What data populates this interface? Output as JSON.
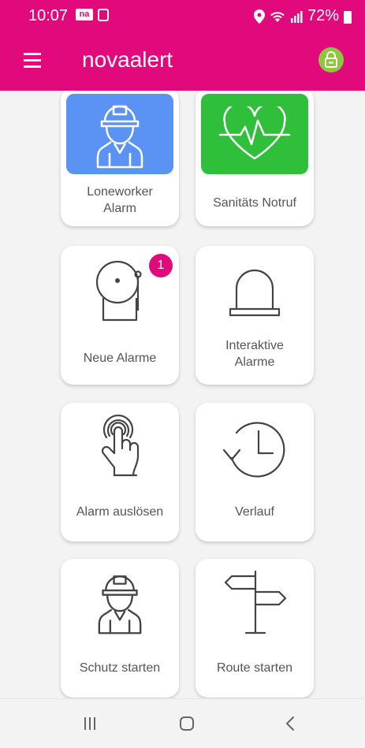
{
  "status": {
    "time": "10:07",
    "app_badge": "na",
    "battery": "72%"
  },
  "appbar": {
    "title": "novaalert",
    "menu_icon": "hamburger-menu-icon",
    "lock_icon": "lock-icon"
  },
  "tiles": [
    {
      "label": "Loneworker\nAlarm",
      "icon": "worker-icon"
    },
    {
      "label": "Sanitäts Notruf",
      "icon": "heart-pulse-icon"
    },
    {
      "label": "Neue Alarme",
      "icon": "bell-icon",
      "badge": "1"
    },
    {
      "label": "Interaktive\nAlarme",
      "icon": "siren-icon"
    },
    {
      "label": "Alarm auslösen",
      "icon": "touch-hand-icon"
    },
    {
      "label": "Verlauf",
      "icon": "history-icon"
    },
    {
      "label": "Schutz starten",
      "icon": "worker-icon"
    },
    {
      "label": "Route starten",
      "icon": "signpost-icon"
    }
  ],
  "colors": {
    "brand": "#e2097c",
    "lock_green": "#8ec63f",
    "loneworker_tile": "#5b93f5",
    "sanitaets_tile": "#2fbf3b"
  },
  "navbar": {
    "recents_icon": "recent-apps-icon",
    "home_icon": "home-icon",
    "back_icon": "back-icon"
  }
}
